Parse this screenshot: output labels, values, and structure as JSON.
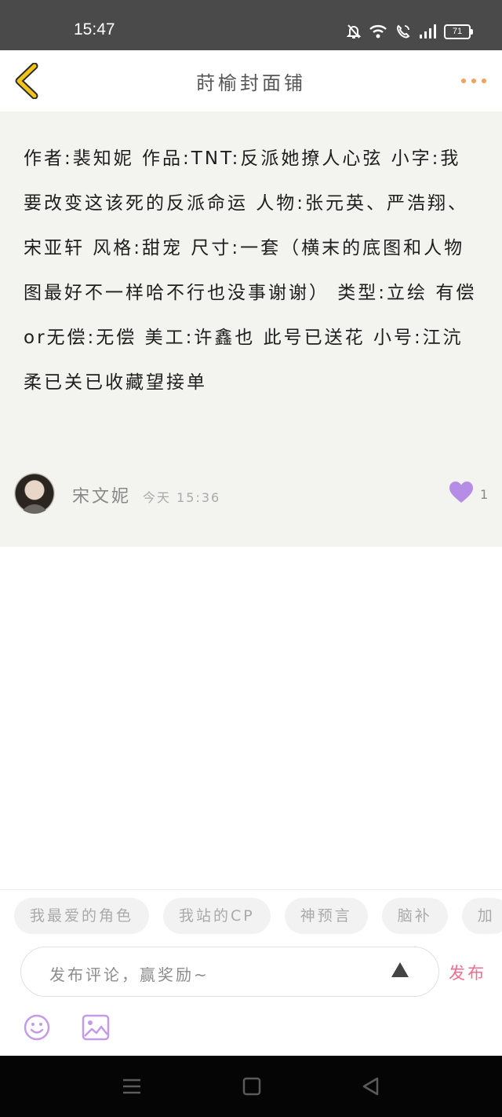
{
  "status_bar": {
    "time": "15:47",
    "battery": "71",
    "icons": [
      "mute-bell-icon",
      "wifi-icon",
      "volte-call-icon",
      "signal-icon",
      "battery-icon"
    ]
  },
  "header": {
    "title": "莳榆封面铺",
    "back_icon": "chevron-left-icon",
    "more_icon": "more-dots-icon"
  },
  "post": {
    "content": "作者:裴知妮 作品:TNT:反派她撩人心弦 小字:我要改变这该死的反派命运 人物:张元英、严浩翔、宋亚轩 风格:甜宠 尺寸:一套（横末的底图和人物图最好不一样哈不行也没事谢谢） 类型:立绘 有偿or无偿:无偿 美工:许鑫也 此号已送花 小号:江沆柔已关已收藏望接单",
    "author": "宋文妮",
    "time": "今天 15:36",
    "likes": "1"
  },
  "bottom": {
    "tags": [
      "我最爱的角色",
      "我站的CP",
      "神预言",
      "脑补",
      "加"
    ],
    "comment_placeholder": "发布评论，赢奖励~",
    "publish_label": "发布"
  },
  "colors": {
    "accent_orange": "#f2a15a",
    "back_arrow_yellow": "#f0c419",
    "like_purple": "#b58ce6",
    "publish_pink": "#ef6d8f",
    "icon_purple": "#c49be8"
  }
}
